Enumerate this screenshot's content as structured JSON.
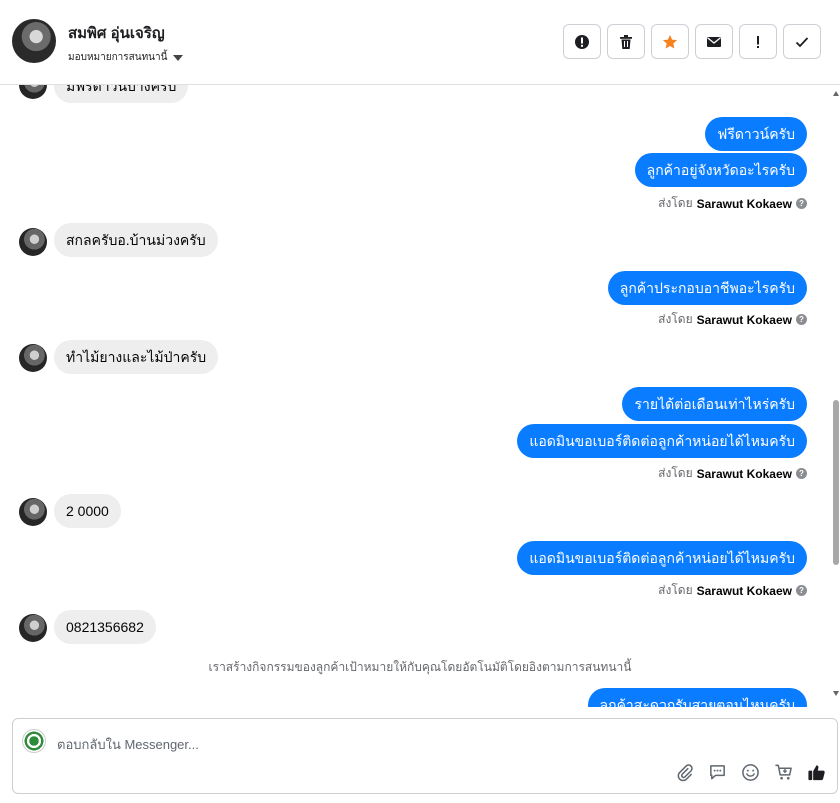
{
  "header": {
    "contact_name": "สมพิศ อุ่นเจริญ",
    "assign_label": "มอบหมายการสนทนานี้",
    "toolbar": [
      {
        "name": "spam-button",
        "icon": "alert-circle-icon"
      },
      {
        "name": "delete-button",
        "icon": "trash-icon"
      },
      {
        "name": "star-button",
        "icon": "star-icon"
      },
      {
        "name": "mark-unread-button",
        "icon": "envelope-icon"
      },
      {
        "name": "follow-up-button",
        "icon": "exclamation-icon"
      },
      {
        "name": "mark-done-button",
        "icon": "check-icon"
      }
    ]
  },
  "messages": {
    "m0_in": "มีฟรีดาวน์บ้างครับ",
    "m1_out": "ฟรีดาวน์ครับ",
    "m2_out": "ลูกค้าอยู่จังหวัดอะไรครับ",
    "sent_by_prefix": "ส่งโดย",
    "sent_by_name": "Sarawut Kokaew",
    "m3_in": "สกลครับอ.บ้านม่วงครับ",
    "m4_out": "ลูกค้าประกอบอาชีพอะไรครับ",
    "m5_in": "ทำไม้ยางและไม้ป่าครับ",
    "m6_out": "รายได้ต่อเดือนเท่าไหร่ครับ",
    "m7_out": "แอดมินขอเบอร์ติดต่อลูกค้าหน่อยได้ไหมครับ",
    "m8_in": "2 0000",
    "m9_out": "แอดมินขอเบอร์ติดต่อลูกค้าหน่อยได้ไหมครับ",
    "m10_in": "0821356682",
    "system_note": "เราสร้างกิจกรรมของลูกค้าเป้าหมายให้กับคุณโดยอัตโนมัติโดยอิงตามการสนทนานี้",
    "m11_out": "ลูกค้าสะดวกรับสายตอนไหนครับ"
  },
  "composer": {
    "placeholder": "ตอบกลับใน Messenger...",
    "actions": [
      "paperclip-icon",
      "saved-replies-icon",
      "emoji-icon",
      "cart-icon",
      "thumbs-up-icon"
    ]
  },
  "colors": {
    "outgoing_bubble": "#0a7cff",
    "incoming_bubble": "#eeeeee",
    "star": "#f5821f"
  }
}
